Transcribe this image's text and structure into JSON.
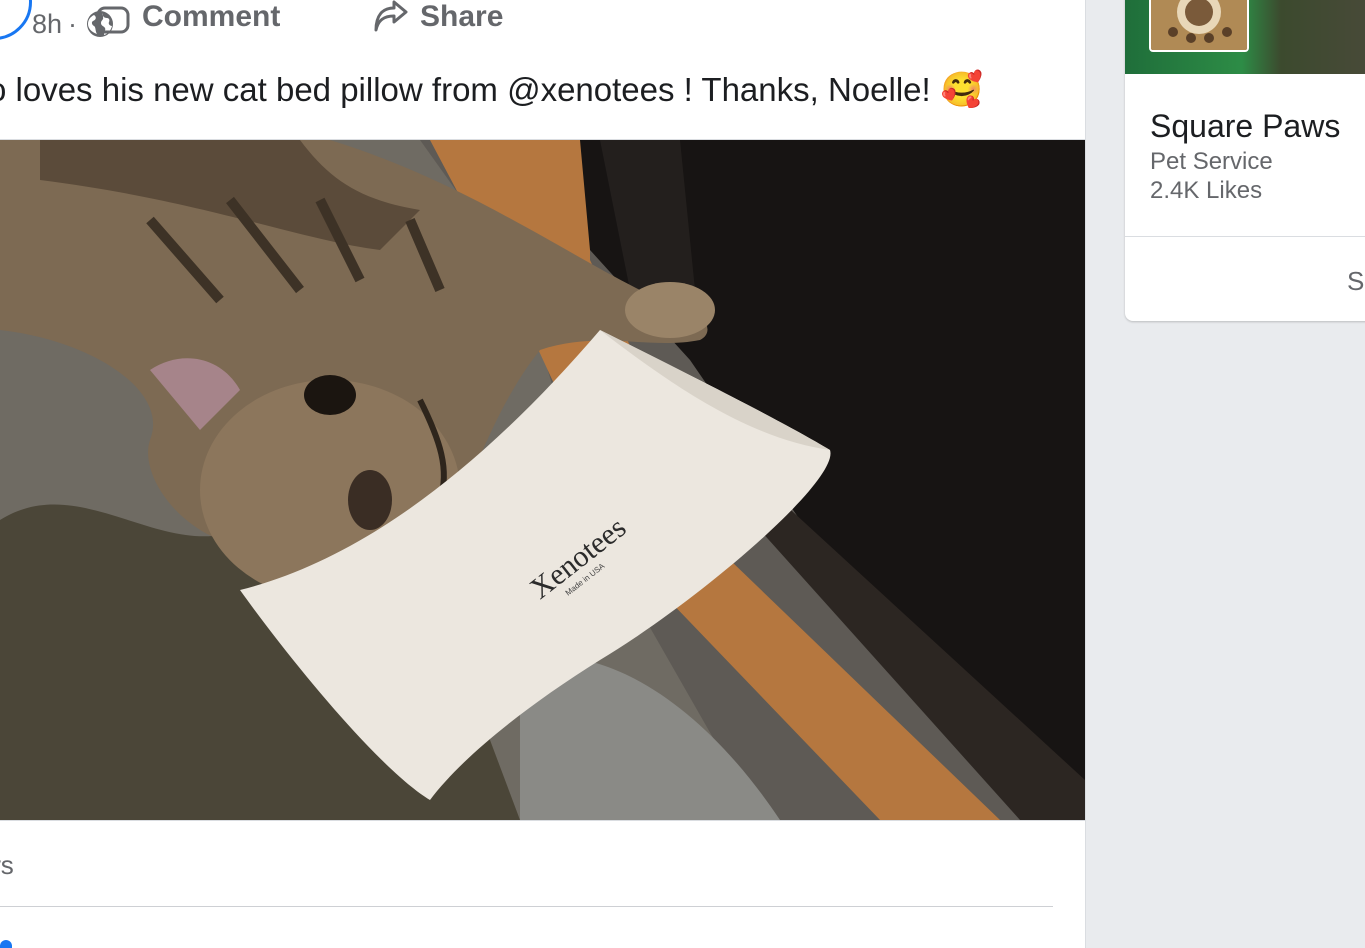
{
  "post": {
    "timestamp": "8h",
    "separator": "·",
    "privacy_icon": "globe-icon",
    "text": "o loves his new cat bed pillow from @xenotees !  Thanks, Noelle!",
    "emoji": "🥰",
    "photo": {
      "pillow_brand": "Xenotees",
      "pillow_subtext": "Made in USA"
    },
    "views": "ws",
    "actions": {
      "comment_label": "Comment",
      "share_label": "Share",
      "comment_icon": "comment-icon",
      "share_icon": "share-icon"
    }
  },
  "sidebar": {
    "page_card": {
      "name": "Square Paws",
      "category": "Pet Service",
      "likes": "2.4K Likes",
      "button_label": "Se"
    }
  },
  "colors": {
    "accent": "#1877f2",
    "secondary_text": "#65676b",
    "background": "#e9ebee"
  }
}
